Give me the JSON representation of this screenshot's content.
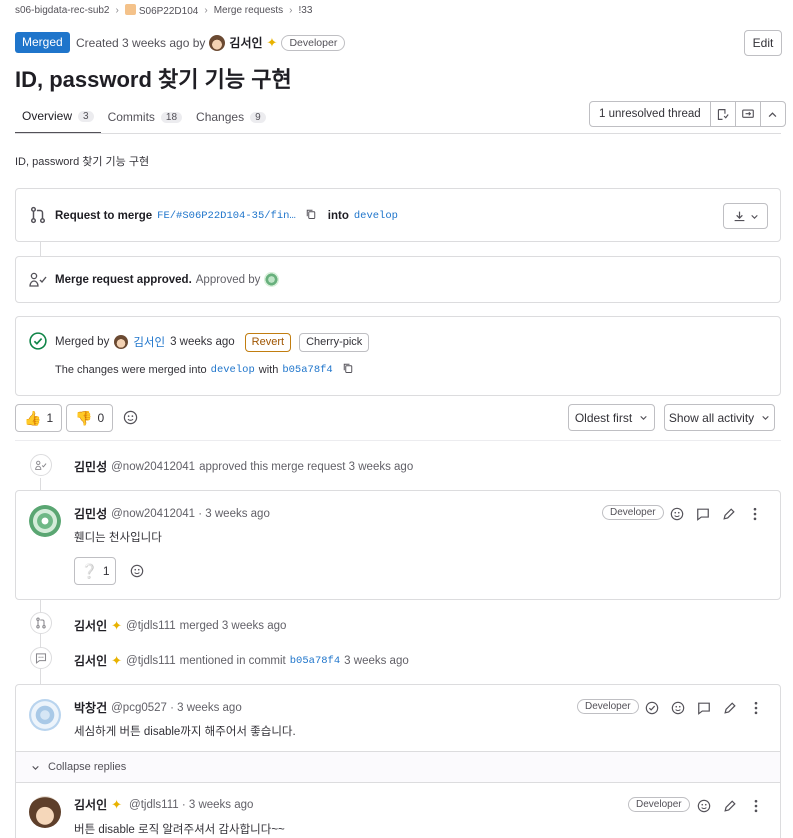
{
  "breadcrumb": {
    "group": "s06-bigdata-rec-sub2",
    "project": "S06P22D104",
    "section": "Merge requests",
    "item": "!33"
  },
  "header": {
    "status": "Merged",
    "created": "Created 3 weeks ago by",
    "author": "김서인",
    "role": "Developer",
    "edit_label": "Edit",
    "title": "ID, password 찾기 기능 구현"
  },
  "tabs": [
    {
      "label": "Overview",
      "count": "3"
    },
    {
      "label": "Commits",
      "count": "18"
    },
    {
      "label": "Changes",
      "count": "9"
    }
  ],
  "thread_box": {
    "label": "1 unresolved thread"
  },
  "description": "ID, password 찾기 기능 구현",
  "widget_request": {
    "label": "Request to merge",
    "source_branch": "FE/#S06P22D104-35/fin…",
    "into": "into",
    "target_branch": "develop"
  },
  "widget_approval": {
    "label": "Merge request approved.",
    "approved_by": "Approved by"
  },
  "widget_merged": {
    "merged_by": "Merged by",
    "user": "김서인",
    "time": "3 weeks ago",
    "revert_label": "Revert",
    "cherry_label": "Cherry-pick",
    "changes_text": "The changes were merged into",
    "branch": "develop",
    "with": "with",
    "commit": "b05a78f4"
  },
  "awards": {
    "thumbs_up": "1",
    "thumbs_down": "0"
  },
  "sort": {
    "order_label": "Oldest first",
    "filter_label": "Show all activity"
  },
  "activity": [
    {
      "name": "김민성",
      "handle": "@now20412041",
      "text": "approved this merge request 3 weeks ago"
    },
    {
      "name": "김서인",
      "handle": "@tjdls111",
      "text": "merged 3 weeks ago"
    },
    {
      "name": "김서인",
      "handle": "@tjdls111",
      "text": "mentioned in commit",
      "commit": "b05a78f4",
      "time": "3 weeks ago"
    }
  ],
  "note1": {
    "name": "김민성",
    "meta": "@now20412041 · 3 weeks ago",
    "role": "Developer",
    "text": "휀디는 천사입니다",
    "reaction_count": "1"
  },
  "note2": {
    "name": "박창건",
    "meta": "@pcg0527 · 3 weeks ago",
    "role": "Developer",
    "text": "세심하게 버튼 disable까지 해주어서 좋습니다.",
    "collapse_label": "Collapse replies"
  },
  "reply1": {
    "name": "김서인",
    "meta": "@tjdls111 · 3 weeks ago",
    "role": "Developer",
    "text": "버튼 disable 로직 알려주셔서 감사합니다~~"
  }
}
